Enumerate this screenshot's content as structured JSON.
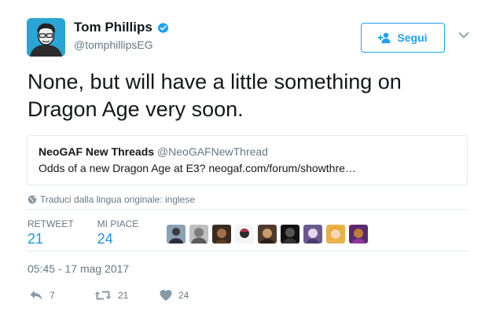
{
  "author": {
    "display_name": "Tom Phillips",
    "handle": "@tomphillipsEG",
    "verified": true
  },
  "follow_button": {
    "label": "Segui"
  },
  "tweet": {
    "text": "None, but will have a little something on Dragon Age very soon."
  },
  "quoted_tweet": {
    "name": "NeoGAF New Threads",
    "handle": "@NeoGAFNewThread",
    "text": "Odds of a new Dragon Age at E3? neogaf.com/forum/showthre…"
  },
  "translate": {
    "label": "Traduci dalla lingua originale: inglese"
  },
  "stats": {
    "retweets_label": "RETWEET",
    "retweets_value": "21",
    "likes_label": "MI PIACE",
    "likes_value": "24"
  },
  "liker_avatars": [
    "liker-1",
    "liker-2",
    "liker-3",
    "liker-4",
    "liker-5",
    "liker-6",
    "liker-7",
    "liker-8",
    "liker-9"
  ],
  "timestamp": "05:45 - 17 mag 2017",
  "actions": {
    "reply_count": "7",
    "retweet_count": "21",
    "like_count": "24"
  },
  "colors": {
    "accent": "#1da1f2",
    "link_blue": "#1b95e0",
    "muted": "#657786",
    "border": "#e1e8ed"
  },
  "icons": [
    "avatar",
    "verified-icon",
    "add-user-icon",
    "chevron-down-icon",
    "globe-icon",
    "reply-icon",
    "retweet-icon",
    "heart-icon"
  ]
}
